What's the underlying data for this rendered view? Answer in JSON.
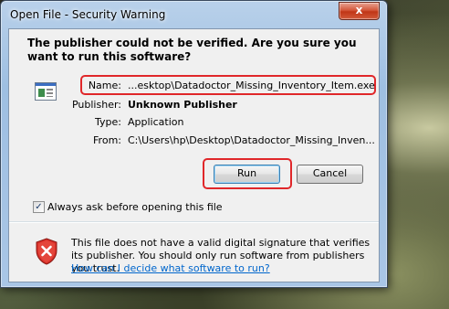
{
  "window": {
    "title": "Open File - Security Warning",
    "close_label": "x"
  },
  "dialog": {
    "heading": "The publisher could not be verified.  Are you sure you want to run this software?",
    "fields": {
      "name": {
        "label": "Name:",
        "value": "...esktop\\Datadoctor_Missing_Inventory_Item.exe"
      },
      "publisher": {
        "label": "Publisher:",
        "value": "Unknown Publisher"
      },
      "type": {
        "label": "Type:",
        "value": "Application"
      },
      "from": {
        "label": "From:",
        "value": "C:\\Users\\hp\\Desktop\\Datadoctor_Missing_Inven..."
      }
    },
    "buttons": {
      "run": "Run",
      "cancel": "Cancel"
    },
    "checkbox": {
      "label": "Always ask before opening this file",
      "checked": true,
      "mark": "✓"
    },
    "warning": {
      "text": "This file does not have a valid digital signature that verifies its publisher.  You should only run software from publishers you trust.",
      "link": "How can I decide what software to run?"
    }
  },
  "icons": {
    "app": "application-icon",
    "shield": "security-shield-icon"
  },
  "colors": {
    "highlight": "#e0272a",
    "link": "#0066cc",
    "shield": "#d9302a"
  }
}
